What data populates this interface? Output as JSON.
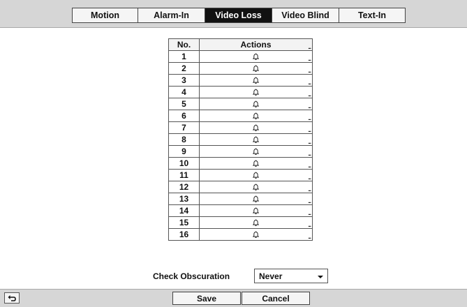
{
  "tabs": [
    {
      "label": "Motion",
      "active": false
    },
    {
      "label": "Alarm-In",
      "active": false
    },
    {
      "label": "Video Loss",
      "active": true
    },
    {
      "label": "Video Blind",
      "active": false
    },
    {
      "label": "Text-In",
      "active": false
    }
  ],
  "table": {
    "headers": {
      "no": "No.",
      "actions": "Actions"
    },
    "ellipsis": "...",
    "rows": [
      {
        "no": "1",
        "action_icon": "bell-icon"
      },
      {
        "no": "2",
        "action_icon": "bell-icon"
      },
      {
        "no": "3",
        "action_icon": "bell-icon"
      },
      {
        "no": "4",
        "action_icon": "bell-icon"
      },
      {
        "no": "5",
        "action_icon": "bell-icon"
      },
      {
        "no": "6",
        "action_icon": "bell-icon"
      },
      {
        "no": "7",
        "action_icon": "bell-icon"
      },
      {
        "no": "8",
        "action_icon": "bell-icon"
      },
      {
        "no": "9",
        "action_icon": "bell-icon"
      },
      {
        "no": "10",
        "action_icon": "bell-icon"
      },
      {
        "no": "11",
        "action_icon": "bell-icon"
      },
      {
        "no": "12",
        "action_icon": "bell-icon"
      },
      {
        "no": "13",
        "action_icon": "bell-icon"
      },
      {
        "no": "14",
        "action_icon": "bell-icon"
      },
      {
        "no": "15",
        "action_icon": "bell-icon"
      },
      {
        "no": "16",
        "action_icon": "bell-icon"
      }
    ]
  },
  "obscuration": {
    "label": "Check Obscuration",
    "value": "Never"
  },
  "footer": {
    "back_icon": "back-arrow-icon",
    "save_label": "Save",
    "cancel_label": "Cancel"
  },
  "colors": {
    "active_tab_bg": "#111111",
    "bar_bg": "#d6d6d6"
  }
}
